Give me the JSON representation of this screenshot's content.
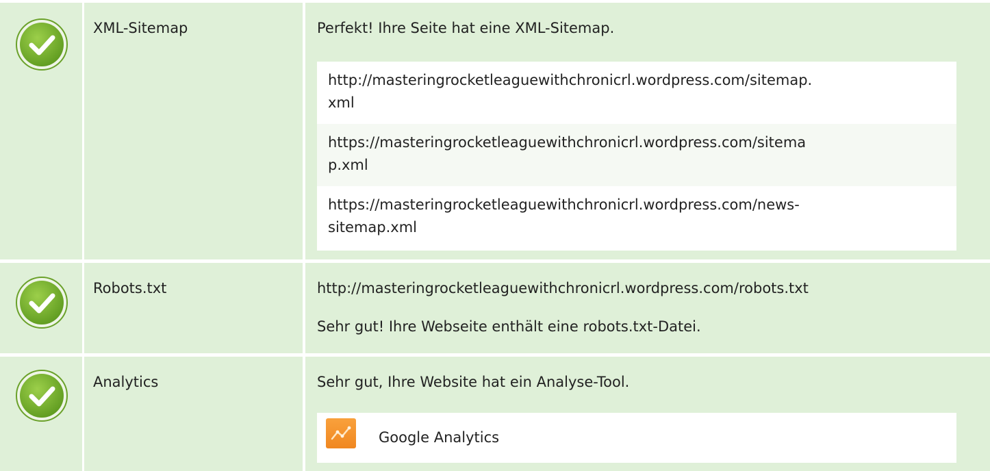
{
  "rows": [
    {
      "status": "passed",
      "label": "XML-Sitemap",
      "message": "Perfekt! Ihre Seite hat eine XML-Sitemap.",
      "sitemaps": [
        {
          "line1": "http://masteringrocketleaguewithchronicrl.wordpress.com/sitemap.",
          "line2": "xml"
        },
        {
          "line1": "https://masteringrocketleaguewithchronicrl.wordpress.com/sitema",
          "line2": "p.xml"
        },
        {
          "line1": "https://masteringrocketleaguewithchronicrl.wordpress.com/news-",
          "line2": "sitemap.xml"
        }
      ]
    },
    {
      "status": "passed",
      "label": "Robots.txt",
      "url": "http://masteringrocketleaguewithchronicrl.wordpress.com/robots.txt",
      "message": "Sehr gut! Ihre Webseite enthält eine robots.txt-Datei."
    },
    {
      "status": "passed",
      "label": "Analytics",
      "message": "Sehr gut, Ihre Website hat ein Analyse-Tool.",
      "tool": {
        "icon": "google-analytics-icon",
        "name": "Google Analytics"
      }
    }
  ],
  "colors": {
    "row_background": "#dff0d8",
    "check_green": "#7ab42e",
    "box_background": "#ffffff",
    "box_alt_background": "#f5f9f3"
  }
}
